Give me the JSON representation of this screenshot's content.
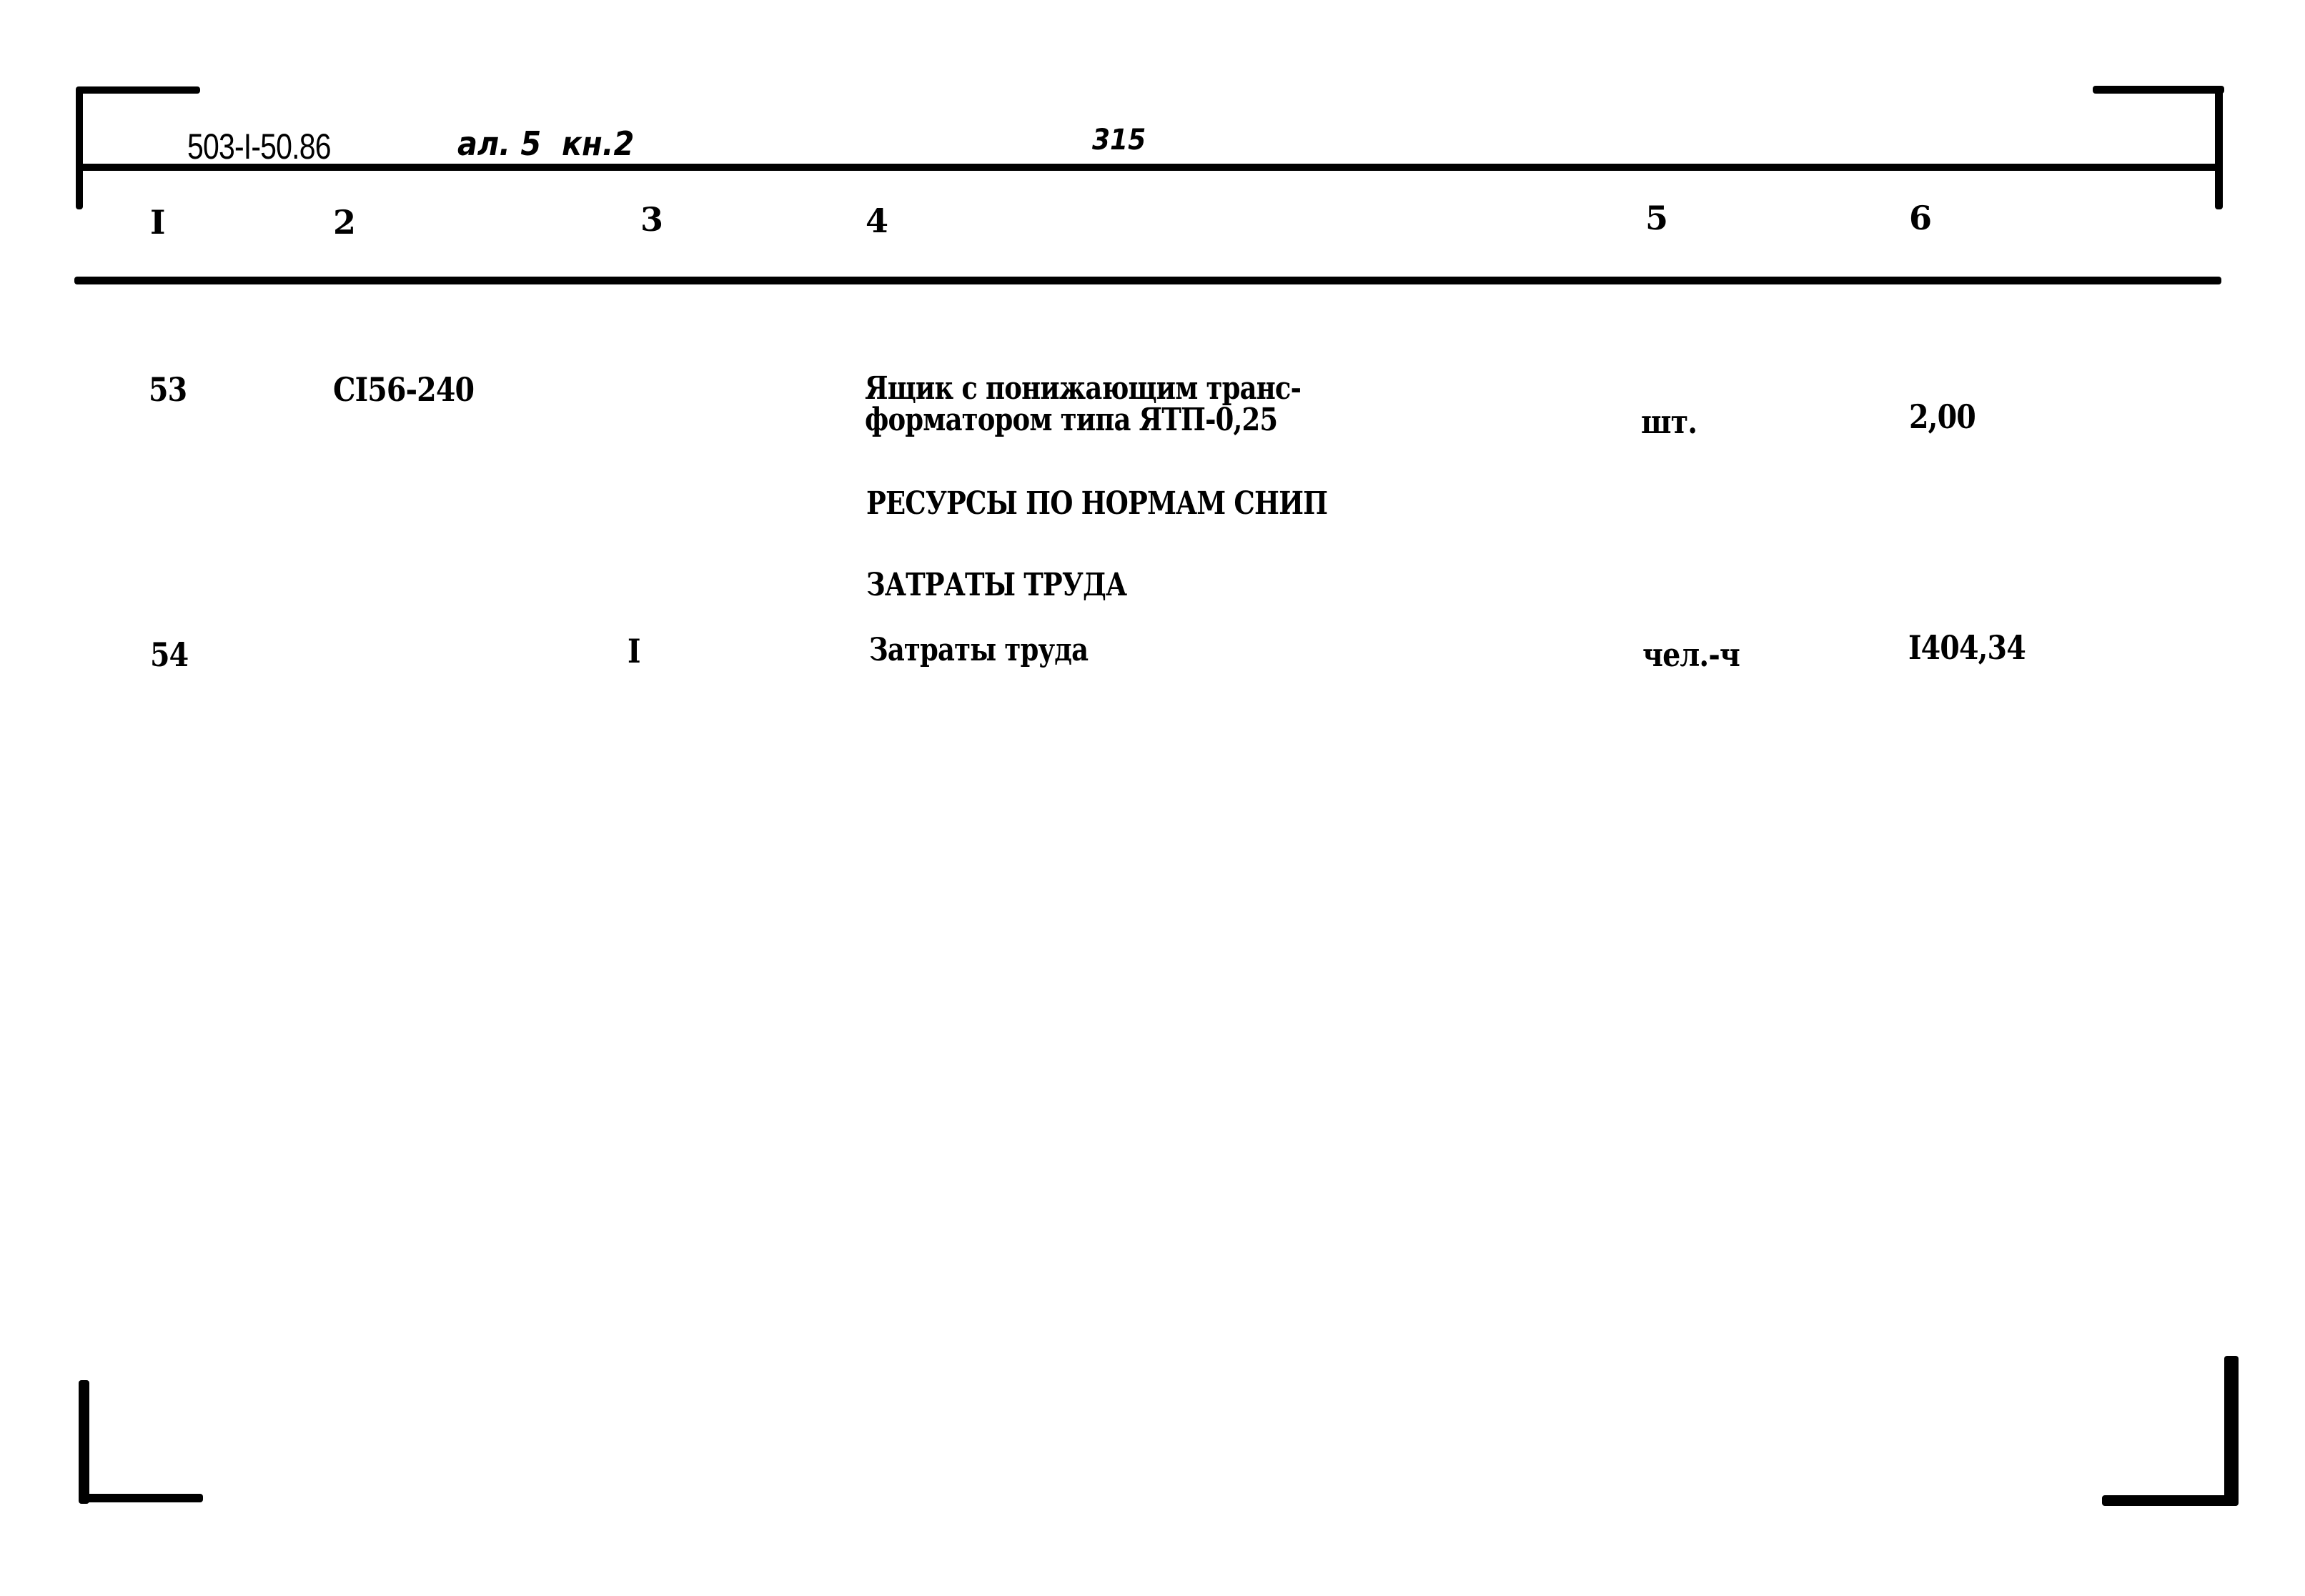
{
  "header": {
    "doc_code": "503-I-50.86",
    "handwritten_note": "ал. 5  кн.2",
    "page_number": "315"
  },
  "columns": [
    "I",
    "2",
    "3",
    "4",
    "5",
    "6"
  ],
  "rows": [
    {
      "num": "53",
      "code": "CI56-240",
      "col3": "",
      "description_line1": "Ящик с понижающим транс-",
      "description_line2": "форматором типа ЯТП-0,25",
      "unit": "шт.",
      "quantity": "2,00"
    },
    {
      "section_title": "РЕСУРСЫ ПО НОРМАМ СНИП"
    },
    {
      "section_title": "ЗАТРАТЫ ТРУДА"
    },
    {
      "num": "54",
      "code": "",
      "col3": "I",
      "description_line1": "Затраты труда",
      "unit": "чел.-ч",
      "quantity": "I404,34"
    }
  ]
}
